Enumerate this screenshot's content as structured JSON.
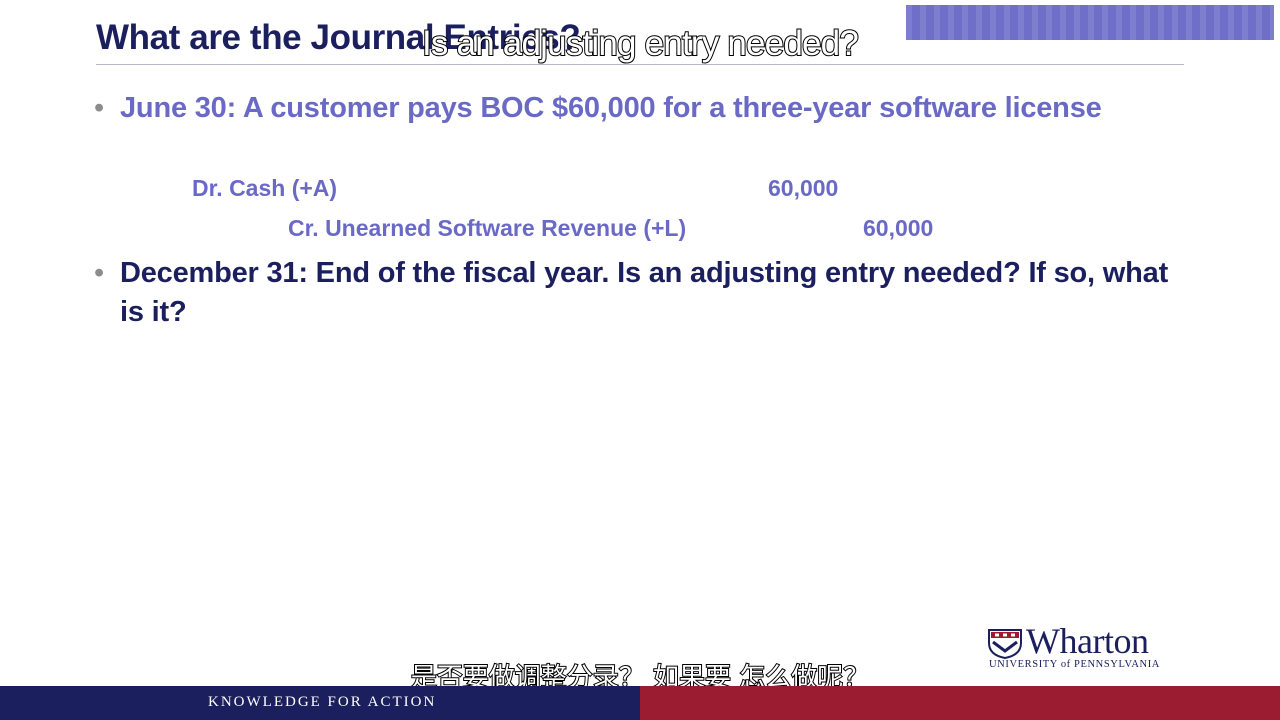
{
  "slide": {
    "title": "What are the Journal Entries?",
    "bullets": [
      {
        "text": "June 30: A customer pays BOC $60,000 for a three-year software license"
      },
      {
        "text": "December 31: End of the fiscal year. Is an adjusting entry needed? If so, what is it?"
      }
    ],
    "journal_entry": {
      "debit": {
        "label": "Dr. Cash (+A)",
        "amount": "60,000"
      },
      "credit": {
        "label": "Cr. Unearned Software Revenue (+L)",
        "amount": "60,000"
      }
    }
  },
  "captions": {
    "english": "Is an adjusting entry needed?",
    "chinese": "是否要做调整分录？ 如果要 怎么做呢？"
  },
  "branding": {
    "logo_word": "Wharton",
    "logo_sub": "UNIVERSITY of PENNSYLVANIA",
    "tagline": "KNOWLEDGE FOR ACTION"
  },
  "colors": {
    "navy": "#1b1f5e",
    "periwinkle": "#6a6ac6",
    "crimson": "#9b1c30"
  }
}
